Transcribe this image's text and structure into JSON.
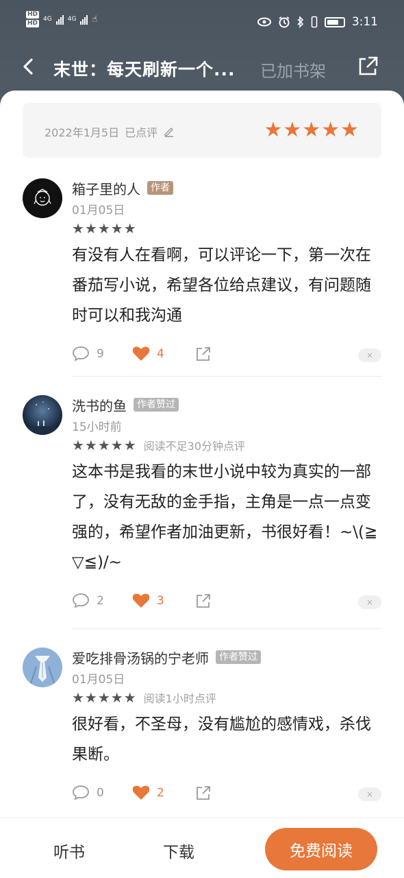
{
  "status": {
    "hd1": "HD",
    "hd2": "HD",
    "net1": "4G",
    "net2": "4G",
    "time": "3:11"
  },
  "header": {
    "title": "末世：每天刷新一个...",
    "shelf_label": "已加书架"
  },
  "my_review": {
    "date": "2022年1月5日",
    "status": "已点评",
    "stars": "★★★★★"
  },
  "comments": [
    {
      "user": "箱子里的人",
      "badge": "作者",
      "time": "01月05日",
      "stars": "★★★★★",
      "note": "",
      "text": "有没有人在看啊，可以评论一下，第一次在番茄写小说，希望各位给点建议，有问题随时可以和我沟通",
      "replies": "9",
      "likes": "4",
      "close": "×"
    },
    {
      "user": "洗书的鱼",
      "badge": "作者赞过",
      "time": "15小时前",
      "stars": "★★★★★",
      "note": "阅读不足30分钟点评",
      "text": "这本书是我看的末世小说中较为真实的一部了，没有无敌的金手指，主角是一点一点变强的，希望作者加油更新，书很好看！~\\(≧▽≦)/~",
      "replies": "2",
      "likes": "3",
      "close": "×"
    },
    {
      "user": "爱吃排骨汤锅的宁老师",
      "badge": "作者赞过",
      "time": "01月05日",
      "stars": "★★★★★",
      "note": "阅读1小时点评",
      "text": "很好看，不圣母，没有尴尬的感情戏，杀伐果断。",
      "replies": "0",
      "likes": "2",
      "close": "×"
    }
  ],
  "bottom": {
    "listen": "听书",
    "download": "下载",
    "read": "免费阅读"
  },
  "colors": {
    "accent": "#e8773a",
    "author_badge": "#b89478",
    "liked_badge": "#b5b5b5"
  }
}
